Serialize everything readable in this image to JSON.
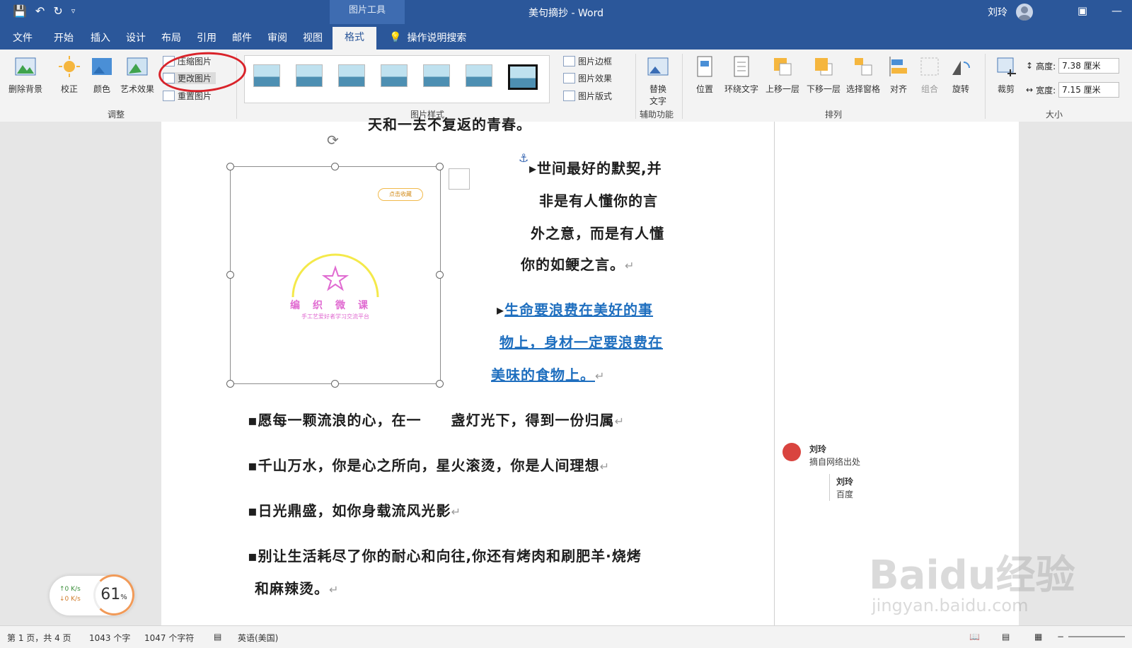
{
  "title_bar": {
    "context_tools": "图片工具",
    "doc_title": "美句摘抄 - Word",
    "user_name": "刘玲",
    "qat_icons": [
      "save-icon",
      "undo-icon",
      "redo-icon",
      "customize-icon"
    ]
  },
  "tabs": [
    {
      "label": "文件"
    },
    {
      "label": "开始"
    },
    {
      "label": "插入"
    },
    {
      "label": "设计"
    },
    {
      "label": "布局"
    },
    {
      "label": "引用"
    },
    {
      "label": "邮件"
    },
    {
      "label": "审阅"
    },
    {
      "label": "视图"
    },
    {
      "label": "格式",
      "active": true
    }
  ],
  "tell_me": "操作说明搜索",
  "ribbon": {
    "adjust": {
      "remove_bg": "删除背景",
      "corrections": "校正",
      "color": "颜色",
      "artistic": "艺术效果",
      "compress": "压缩图片",
      "change": "更改图片",
      "reset": "重置图片",
      "group_label": "调整"
    },
    "styles": {
      "border": "图片边框",
      "effects": "图片效果",
      "layout": "图片版式",
      "group_label": "图片样式"
    },
    "accessibility": {
      "alt_text_1": "替换",
      "alt_text_2": "文字",
      "group_label": "辅助功能"
    },
    "arrange": {
      "position": "位置",
      "wrap": "环绕文字",
      "forward": "上移一层",
      "backward": "下移一层",
      "pane": "选择窗格",
      "align": "对齐",
      "group": "组合",
      "rotate": "旋转",
      "group_label": "排列"
    },
    "size": {
      "crop": "裁剪",
      "height_label": "高度:",
      "height_value": "7.38 厘米",
      "width_label": "宽度:",
      "width_value": "7.15 厘米",
      "group_label": "大小"
    }
  },
  "document": {
    "top_cut": "天和一去不复返的青春。",
    "quote1": [
      "世间最好的默契,并",
      "非是有人懂你的言",
      "外之意，而是有人懂",
      "你的如鲠之言。"
    ],
    "quote2": [
      "生命要浪费在美好的事",
      "物上，身材一定要浪费在",
      "美味的食物上。"
    ],
    "line3": "愿每一颗流浪的心，在一　　盏灯光下，得到一份归属",
    "line4": "千山万水，你是心之所向，星火滚烫，你是人间理想",
    "line5": "日光鼎盛，如你身载流风光影",
    "line6a": "别让生活耗尽了你的耐心和向往,你还有烤肉和刷肥羊·烧烤",
    "line6b": "和麻辣烫。",
    "image": {
      "badge": "点击收藏",
      "title": "编织微课",
      "subtitle": "手工艺爱好者学习交流平台"
    }
  },
  "comments": [
    {
      "author": "刘玲",
      "text": "摘自网络出处"
    },
    {
      "author": "刘玲",
      "text": "百度"
    }
  ],
  "status": {
    "page": "第 1 页，共 4 页",
    "words": "1043 个字",
    "chars": "1047 个字符",
    "lang": "英语(美国)"
  },
  "speed_widget": {
    "up": "0 K/s",
    "down": "0 K/s",
    "percent": "61",
    "unit": "%"
  },
  "watermark": {
    "main": "Baidu经验",
    "sub": "jingyan.baidu.com"
  },
  "colors": {
    "titlebar": "#2b579a",
    "accent_link": "#1f6fbf",
    "annotation_red": "#d9232a"
  }
}
